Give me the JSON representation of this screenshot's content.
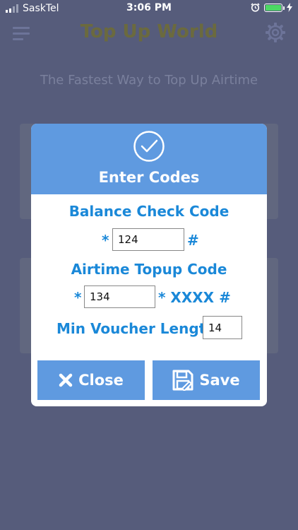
{
  "status_bar": {
    "carrier": "SaskTel",
    "time": "3:06 PM"
  },
  "app": {
    "title": "Top Up World",
    "tagline": "The Fastest Way to Top Up Airtime"
  },
  "dialog": {
    "title": "Enter Codes",
    "balance_label": "Balance Check Code",
    "balance_prefix": "*",
    "balance_value": "124",
    "balance_suffix": "#",
    "airtime_label": "Airtime Topup Code",
    "airtime_prefix": "*",
    "airtime_value": "134",
    "airtime_suffix": "* XXXX #",
    "min_voucher_label": "Min Voucher Length",
    "min_voucher_value": "14",
    "close_label": "Close",
    "save_label": "Save"
  },
  "colors": {
    "overlay_bg": "#565c7b",
    "accent_blue": "#5f9ae0",
    "label_blue": "#1a88d8",
    "battery_green": "#4cd964"
  },
  "icons": [
    "menu-icon",
    "gear-icon",
    "check-circle-icon",
    "close-x-icon",
    "floppy-save-icon",
    "alarm-icon",
    "battery-icon",
    "signal-icon"
  ]
}
